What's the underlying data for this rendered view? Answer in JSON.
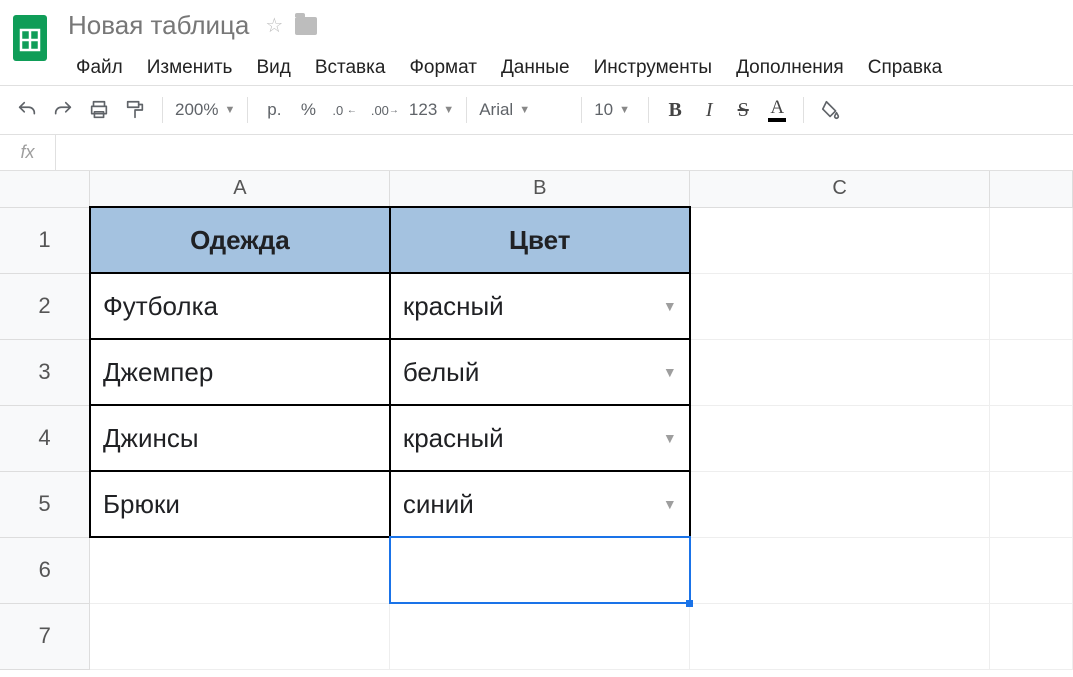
{
  "doc": {
    "title": "Новая таблица"
  },
  "menu": {
    "file": "Файл",
    "edit": "Изменить",
    "view": "Вид",
    "insert": "Вставка",
    "format": "Формат",
    "data": "Данные",
    "tools": "Инструменты",
    "addons": "Дополнения",
    "help": "Справка"
  },
  "toolbar": {
    "zoom": "200%",
    "currency": "р.",
    "percent": "%",
    "dec_less": ".0",
    "dec_more": ".00",
    "numfmt": "123",
    "font": "Arial",
    "size": "10",
    "bold": "B",
    "italic": "I",
    "strike": "S",
    "textcolor": "A"
  },
  "fx": {
    "label": "fx",
    "value": ""
  },
  "columns": {
    "A": "A",
    "B": "B",
    "C": "C"
  },
  "rows": {
    "r1": "1",
    "r2": "2",
    "r3": "3",
    "r4": "4",
    "r5": "5",
    "r6": "6",
    "r7": "7"
  },
  "sheet": {
    "headers": {
      "A": "Одежда",
      "B": "Цвет"
    },
    "data": [
      {
        "A": "Футболка",
        "B": "красный"
      },
      {
        "A": "Джемпер",
        "B": "белый"
      },
      {
        "A": "Джинсы",
        "B": "красный"
      },
      {
        "A": "Брюки",
        "B": "синий"
      }
    ]
  }
}
